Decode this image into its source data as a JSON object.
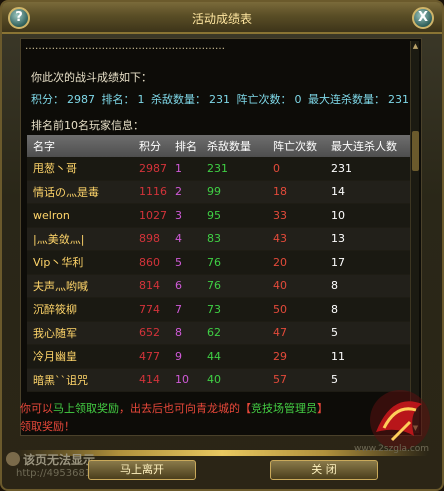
{
  "window": {
    "title": "活动成绩表",
    "help_icon": "question-icon",
    "close_icon": "x-icon",
    "help_label": "?",
    "close_label": "X"
  },
  "panel": {
    "top_cut_text": "……………………………………………………",
    "intro": "你此次的战斗成绩如下：",
    "stats": {
      "score_label": "积分：",
      "score": "2987",
      "rank_label": "排名：",
      "rank": "1",
      "kills_label": "杀敌数量：",
      "kills": "231",
      "deaths_label": "阵亡次数：",
      "deaths": "0",
      "streak_label": "最大连杀数量：",
      "streak": "231"
    },
    "top10_title": "排名前10名玩家信息：",
    "columns": [
      "名字",
      "积分",
      "排名",
      "杀敌数量",
      "阵亡次数",
      "最大连杀人数"
    ],
    "rows": [
      {
        "name": "甩葱丶哥",
        "score": "2987",
        "rank": "1",
        "kills": "231",
        "deaths": "0",
        "streak": "231"
      },
      {
        "name": "情话の灬是毒",
        "score": "1116",
        "rank": "2",
        "kills": "99",
        "deaths": "18",
        "streak": "14"
      },
      {
        "name": "welron",
        "score": "1027",
        "rank": "3",
        "kills": "95",
        "deaths": "33",
        "streak": "10"
      },
      {
        "name": "|灬美敛灬|",
        "score": "898",
        "rank": "4",
        "kills": "83",
        "deaths": "43",
        "streak": "13"
      },
      {
        "name": "Vip丶华利",
        "score": "860",
        "rank": "5",
        "kills": "76",
        "deaths": "20",
        "streak": "17"
      },
      {
        "name": "夫声灬哟喊",
        "score": "814",
        "rank": "6",
        "kills": "76",
        "deaths": "40",
        "streak": "8"
      },
      {
        "name": "沉醉筱柳",
        "score": "774",
        "rank": "7",
        "kills": "73",
        "deaths": "50",
        "streak": "8"
      },
      {
        "name": "我心随军",
        "score": "652",
        "rank": "8",
        "kills": "62",
        "deaths": "47",
        "streak": "5"
      },
      {
        "name": "冷月幽皇",
        "score": "477",
        "rank": "9",
        "kills": "44",
        "deaths": "29",
        "streak": "11"
      },
      {
        "name": "暗黑``诅咒",
        "score": "414",
        "rank": "10",
        "kills": "40",
        "deaths": "57",
        "streak": "5"
      }
    ]
  },
  "footer": {
    "line1_a": "你可以",
    "line1_b": "马上领取奖励",
    "line1_c": "，出去后也可向青龙城的【",
    "line1_d": "竞技场管理员",
    "line1_e": "】",
    "line2": "领取奖励！"
  },
  "buttons": {
    "leave": "马上离开",
    "close": "关    闭"
  },
  "watermarks": {
    "left_text": "该页无法显示",
    "url": "http://495368175.qzone.qq.com",
    "right_text": "www.2szgla.com"
  },
  "colors": {
    "name": "#ffd56a",
    "score": "#d4333a",
    "rank": "#d05ad8",
    "kills": "#3fcf44",
    "deaths": "#e34a3a",
    "streak": "#ffffff",
    "stats": "#7fd8e8"
  }
}
